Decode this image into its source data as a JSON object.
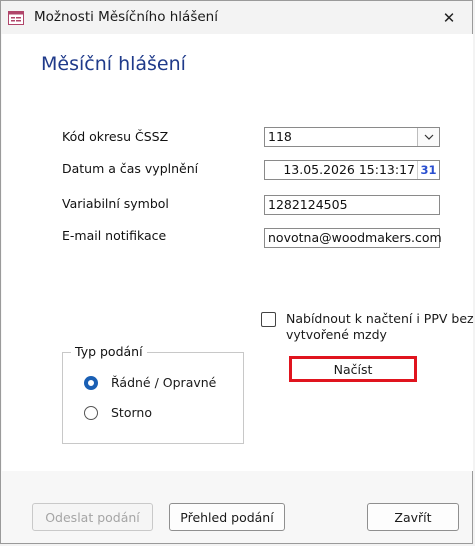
{
  "window": {
    "title": "Možnosti Měsíčního hlášení",
    "close_glyph": "✕",
    "app_icon": "form-icon"
  },
  "heading": "Měsíční hlášení",
  "form": {
    "kod_okresu": {
      "label": "Kód okresu ČSSZ",
      "value": "118"
    },
    "datum": {
      "label": "Datum a čas vyplnění",
      "value": "13.05.2026 15:13:17",
      "calendar": "31"
    },
    "variabilni": {
      "label": "Variabilní symbol",
      "value": "1282124505"
    },
    "email": {
      "label": "E-mail notifikace",
      "value": "novotna@woodmakers.com"
    }
  },
  "checkbox": {
    "label": "Nabídnout k načtení i PPV bez vytvořené mzdy",
    "checked": false
  },
  "group": {
    "legend": "Typ podání",
    "options": [
      {
        "label": "Řádné / Opravné",
        "selected": true
      },
      {
        "label": "Storno",
        "selected": false
      }
    ]
  },
  "load_button": "Načíst",
  "footer": {
    "send": "Odeslat podání",
    "overview": "Přehled podání",
    "close": "Zavřít"
  },
  "colors": {
    "heading": "#1f3a8a",
    "highlight_border": "#e0141e",
    "radio_selected": "#1a5fb4"
  }
}
